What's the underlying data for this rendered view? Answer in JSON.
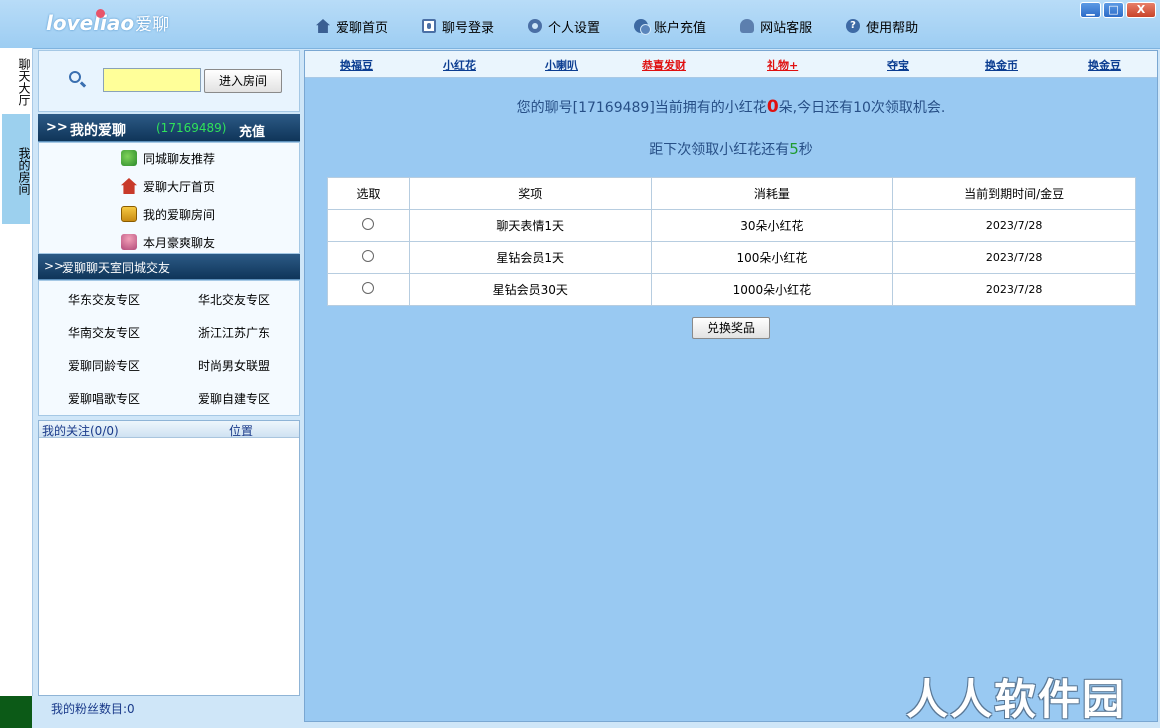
{
  "app": {
    "logo_text": "loveliao",
    "logo_cn": "爱聊"
  },
  "topnav": [
    {
      "label": "爱聊首页",
      "icon": "home-icon"
    },
    {
      "label": "聊号登录",
      "icon": "login-icon"
    },
    {
      "label": "个人设置",
      "icon": "gear-icon"
    },
    {
      "label": "账户充值",
      "icon": "coin-icon"
    },
    {
      "label": "网站客服",
      "icon": "service-icon"
    },
    {
      "label": "使用帮助",
      "icon": "help-icon"
    }
  ],
  "window_buttons": {
    "minimize": "▁",
    "maximize": "□",
    "close": "X"
  },
  "vtabs": [
    "聊天大厅",
    "我的房间"
  ],
  "search": {
    "input_value": "",
    "button": "进入房间"
  },
  "my_section": {
    "arrows": ">>",
    "title": "我的爱聊",
    "id": "(17169489)",
    "recharge": "充值",
    "items": [
      "同城聊友推荐",
      "爱聊大厅首页",
      "我的爱聊房间",
      "本月豪爽聊友"
    ]
  },
  "city_section": {
    "arrows": ">>",
    "title": "爱聊聊天室同城交友",
    "zones": [
      "华东交友专区",
      "华北交友专区",
      "华南交友专区",
      "浙江江苏广东",
      "爱聊同龄专区",
      "时尚男女联盟",
      "爱聊唱歌专区",
      "爱聊自建专区"
    ]
  },
  "follow": {
    "col1": "我的关注(0/0)",
    "col2": "位置"
  },
  "fans": {
    "label": "我的粉丝数目:0"
  },
  "subnav": [
    {
      "label": "换福豆",
      "color": "#0b3d91"
    },
    {
      "label": "小红花",
      "color": "#0b3d91"
    },
    {
      "label": "小喇叭",
      "color": "#0b3d91"
    },
    {
      "label": "恭喜发财",
      "color": "#e01010"
    },
    {
      "label": "礼物+",
      "color": "#e01010"
    },
    {
      "label": "夺宝",
      "color": "#0b3d91"
    },
    {
      "label": "换金币",
      "color": "#0b3d91"
    },
    {
      "label": "换金豆",
      "color": "#0b3d91"
    }
  ],
  "message": {
    "prefix": "您的聊号[17169489]当前拥有的小红花",
    "count": "0",
    "suffix": "朵,今日还有10次领取机会.",
    "next_prefix": "距下次领取小红花还有",
    "next_seconds": "5",
    "next_suffix": "秒"
  },
  "prize_table": {
    "headers": [
      "选取",
      "奖项",
      "消耗量",
      "当前到期时间/金豆"
    ],
    "rows": [
      {
        "item": "聊天表情1天",
        "cost": "30朵小红花",
        "date": "2023/7/28"
      },
      {
        "item": "星钻会员1天",
        "cost": "100朵小红花",
        "date": "2023/7/28"
      },
      {
        "item": "星钻会员30天",
        "cost": "1000朵小红花",
        "date": "2023/7/28"
      }
    ]
  },
  "exchange_button": "兑换奖品",
  "watermark": "人人软件园"
}
